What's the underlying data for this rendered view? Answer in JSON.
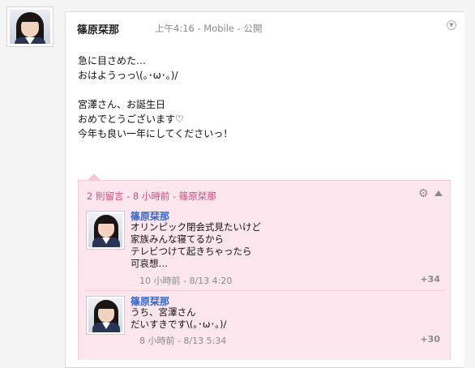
{
  "post": {
    "author": "篠原栞那",
    "meta": "上午4:16  -  Mobile  -  公開",
    "body": "急に目さめた…\nおはようっっ\\(｡･ω･｡)/\n\n宮澤さん、お誕生日\nおめでとうございます♡\n今年も良い一年にしてくださいっ！"
  },
  "comments": {
    "header": "2 則留言 - 8 小時前 - 篠原栞那",
    "items": [
      {
        "author": "篠原栞那",
        "text": "オリンピック閉会式見たいけど\n家族みんな寝てるから\nテレビつけて起きちゃったら\n可哀想…",
        "time": "10 小時前 - 8/13 4:20",
        "plus": "+34"
      },
      {
        "author": "篠原栞那",
        "text": "うち、宮澤さん\nだいすきです\\(｡･ω･｡)/",
        "time": "8 小時前 - 8/13 5:34",
        "plus": "+30"
      }
    ]
  },
  "icons": {
    "menu": "chevron-down-circle-icon",
    "gear": "gear-icon",
    "collapse": "collapse-up-icon"
  },
  "colors": {
    "comment_bg": "#fde6ee",
    "comment_header": "#d44c7c",
    "author_link": "#3366cc"
  }
}
